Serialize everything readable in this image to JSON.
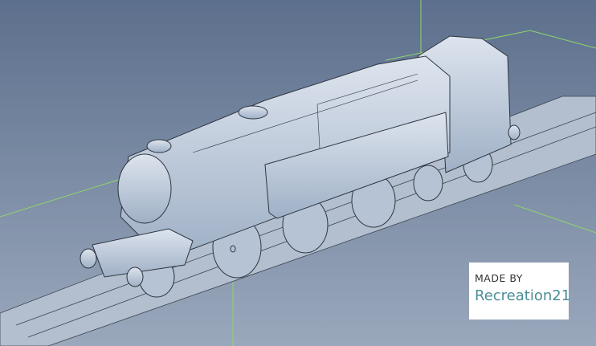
{
  "scene": {
    "subject": "locomotive-3d-model",
    "background_top": "#5c6f8c",
    "background_bottom": "#98a6ba",
    "axis_color": "#8fd46a",
    "model_color": "#c9d4e2"
  },
  "badge": {
    "line1": "MADE BY",
    "line2": "Recreation21"
  }
}
